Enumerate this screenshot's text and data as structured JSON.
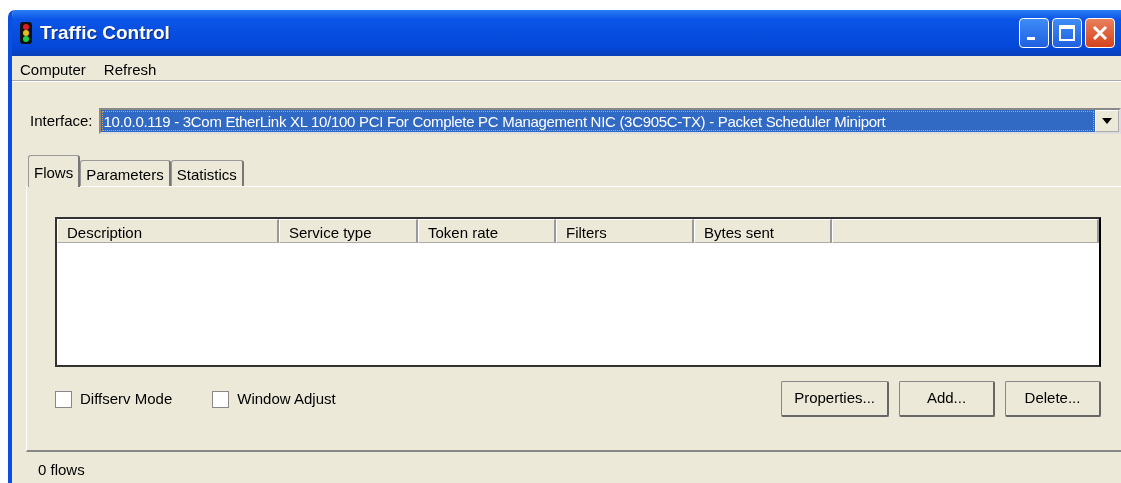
{
  "window": {
    "title": "Traffic Control"
  },
  "menu": [
    {
      "label": "Computer"
    },
    {
      "label": "Refresh"
    }
  ],
  "interface": {
    "label": "Interface:",
    "value": "10.0.0.119 - 3Com EtherLink XL 10/100 PCI For Complete PC Management NIC (3C905C-TX) - Packet Scheduler Miniport"
  },
  "tabs": [
    {
      "label": "Flows",
      "selected": true
    },
    {
      "label": "Parameters",
      "selected": false
    },
    {
      "label": "Statistics",
      "selected": false
    }
  ],
  "table": {
    "columns": [
      "Description",
      "Service type",
      "Token rate",
      "Filters",
      "Bytes sent"
    ]
  },
  "options": [
    {
      "label": "Diffserv Mode",
      "checked": false
    },
    {
      "label": "Window Adjust",
      "checked": false
    }
  ],
  "buttons": [
    "Properties...",
    "Add...",
    "Delete..."
  ],
  "status_bar": "0 flows"
}
